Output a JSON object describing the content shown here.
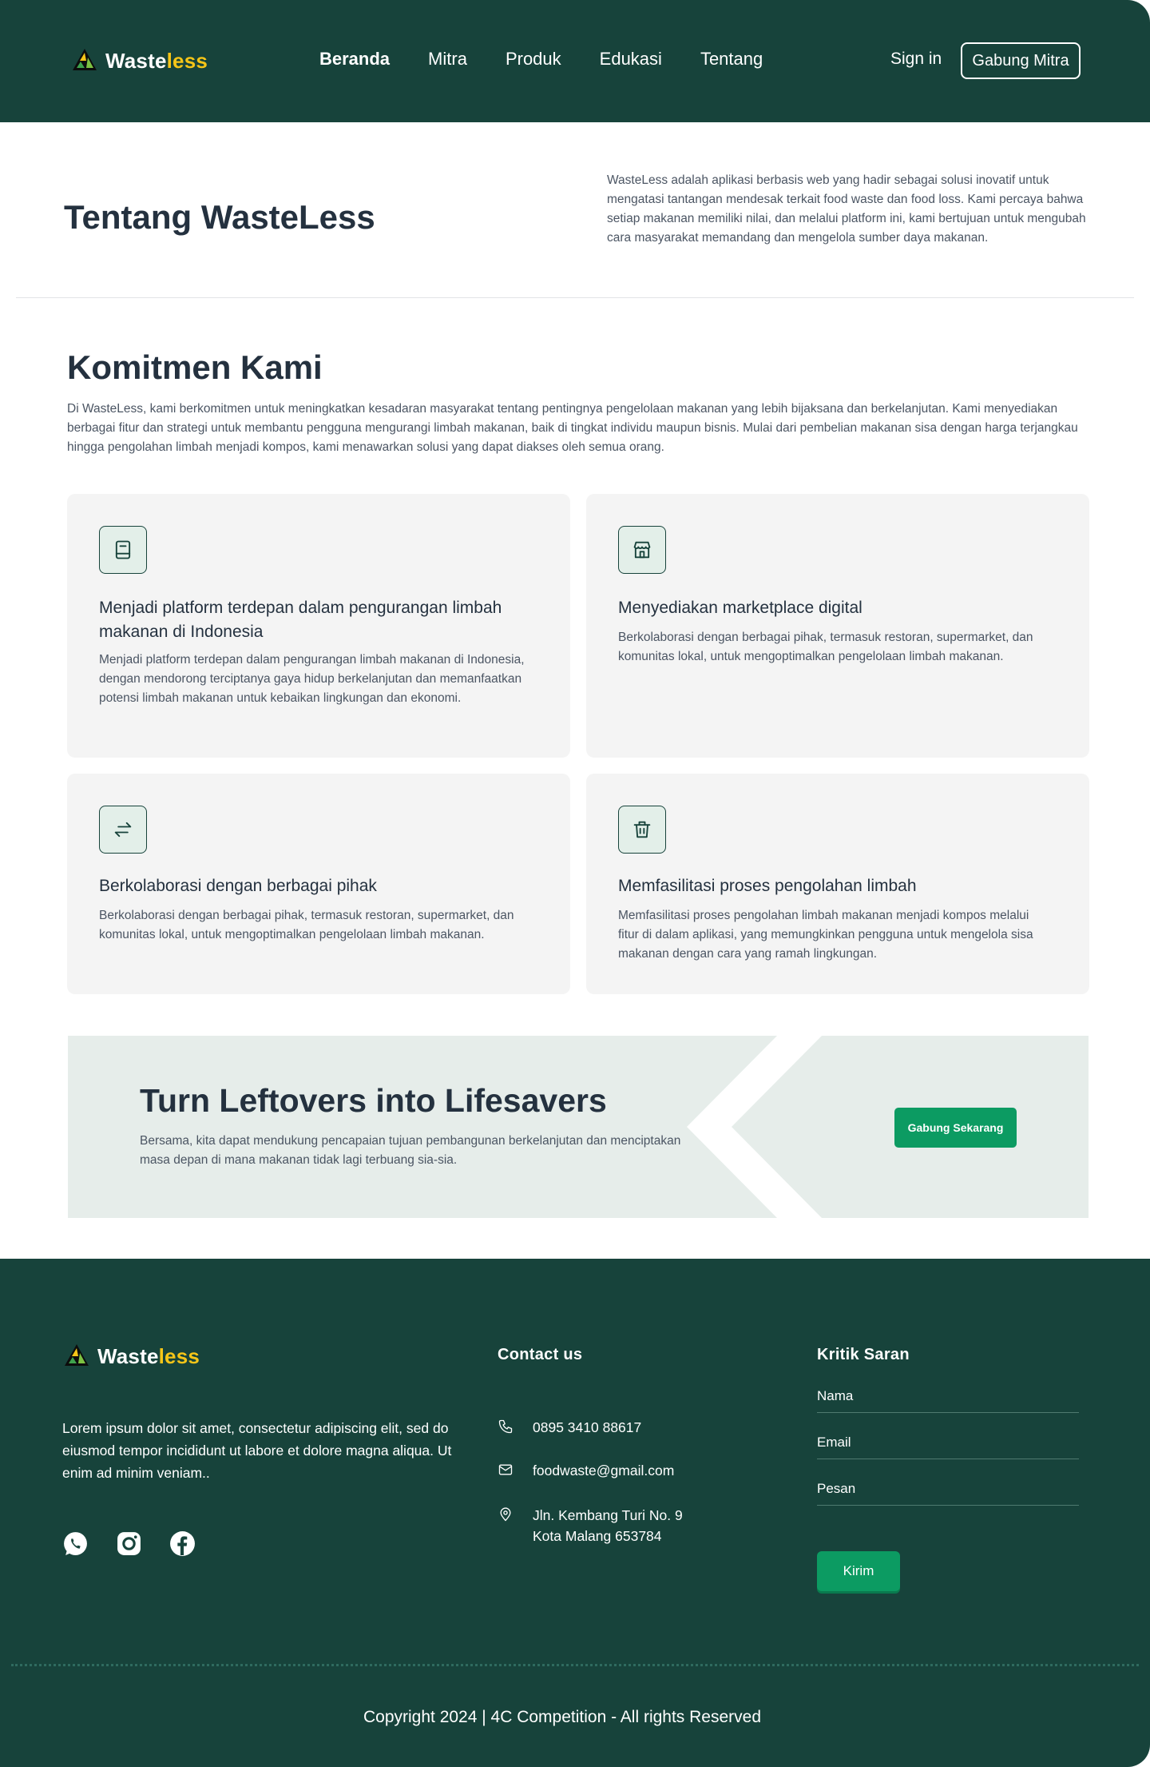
{
  "header": {
    "logo": {
      "main": "Waste",
      "accent": "less"
    },
    "nav": [
      "Beranda",
      "Mitra",
      "Produk",
      "Edukasi",
      "Tentang"
    ],
    "active_nav": "Beranda",
    "signin": "Sign in",
    "join": "Gabung Mitra"
  },
  "about": {
    "title": "Tentang WasteLess",
    "text": "WasteLess adalah aplikasi berbasis web yang hadir sebagai solusi inovatif untuk mengatasi tantangan mendesak terkait food waste dan food loss. Kami percaya bahwa setiap makanan memiliki nilai, dan melalui platform ini, kami bertujuan untuk mengubah cara masyarakat memandang dan mengelola sumber daya makanan."
  },
  "komitmen": {
    "title": "Komitmen Kami",
    "text": "Di WasteLess, kami berkomitmen untuk meningkatkan kesadaran masyarakat tentang pentingnya pengelolaan makanan yang lebih bijaksana dan berkelanjutan. Kami menyediakan berbagai fitur dan strategi untuk membantu pengguna mengurangi limbah makanan, baik di tingkat individu maupun bisnis. Mulai dari pembelian makanan sisa dengan harga terjangkau hingga pengolahan limbah menjadi kompos, kami menawarkan solusi yang dapat diakses oleh semua orang.",
    "cards": [
      {
        "icon": "book-icon",
        "title": "Menjadi platform terdepan dalam pengurangan limbah makanan di Indonesia",
        "text": "Menjadi platform terdepan dalam pengurangan limbah makanan di Indonesia, dengan mendorong terciptanya gaya hidup berkelanjutan dan memanfaatkan potensi limbah makanan untuk kebaikan lingkungan dan ekonomi."
      },
      {
        "icon": "store-icon",
        "title": "Menyediakan marketplace digital",
        "text": "Berkolaborasi dengan berbagai pihak, termasuk restoran, supermarket, dan komunitas lokal, untuk mengoptimalkan pengelolaan limbah makanan."
      },
      {
        "icon": "arrows-exchange-icon",
        "title": "Berkolaborasi dengan berbagai pihak",
        "text": "Berkolaborasi dengan berbagai pihak, termasuk restoran, supermarket, dan komunitas lokal, untuk mengoptimalkan pengelolaan limbah makanan."
      },
      {
        "icon": "trash-icon",
        "title": "Memfasilitasi proses pengolahan limbah",
        "text": "Memfasilitasi proses pengolahan limbah makanan menjadi kompos melalui fitur di dalam aplikasi, yang memungkinkan pengguna untuk mengelola sisa makanan dengan cara yang ramah lingkungan."
      }
    ]
  },
  "cta": {
    "title": "Turn Leftovers into Lifesavers",
    "text": "Bersama, kita dapat mendukung pencapaian tujuan pembangunan berkelanjutan dan menciptakan masa depan di mana makanan tidak lagi terbuang sia-sia.",
    "button": "Gabung Sekarang"
  },
  "footer": {
    "logo": {
      "main": "Waste",
      "accent": "less"
    },
    "description": "Lorem ipsum dolor sit amet, consectetur adipiscing elit, sed do eiusmod tempor incididunt ut labore et dolore magna aliqua. Ut enim ad minim veniam..",
    "socials": [
      "whatsapp-icon",
      "instagram-icon",
      "facebook-icon"
    ],
    "contact": {
      "heading": "Contact us",
      "phone": "0895 3410 88617",
      "email": "foodwaste@gmail.com",
      "address_line1": "Jln. Kembang Turi No. 9",
      "address_line2": "Kota Malang 653784"
    },
    "feedback": {
      "heading": "Kritik Saran",
      "name_placeholder": "Nama",
      "email_placeholder": "Email",
      "message_placeholder": "Pesan",
      "submit": "Kirim"
    },
    "copyright": "Copyright 2024 | 4C Competition - All rights Reserved"
  },
  "colors": {
    "primary_dark": "#17433b",
    "accent_yellow": "#f5c518",
    "button_green": "#0c9b62",
    "card_bg": "#f4f4f4",
    "cta_bg": "#e6edea"
  }
}
